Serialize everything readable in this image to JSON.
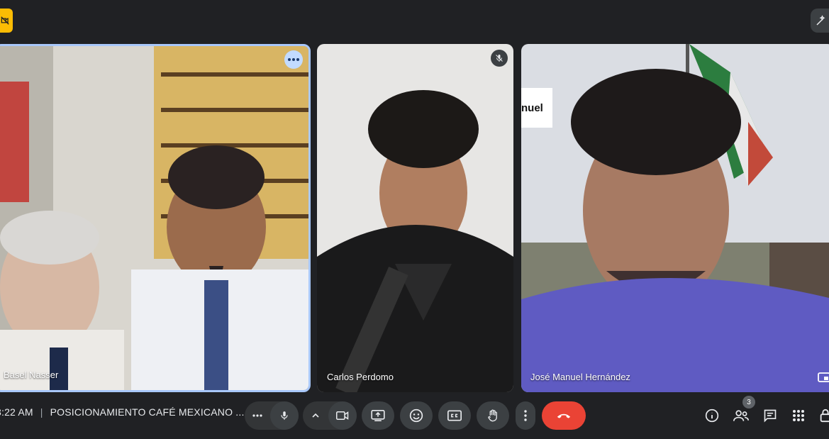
{
  "participants": [
    {
      "name": "Basel Nasser"
    },
    {
      "name": "Carlos Perdomo"
    },
    {
      "name": "José Manuel Hernández"
    }
  ],
  "overlay_text": "nuel",
  "meeting": {
    "time": "3:22 AM",
    "title": "POSICIONAMIENTO CAFÉ MEXICANO ..."
  },
  "people_count": "3",
  "icons": [
    "camera-off-icon",
    "sparkle-pen-icon",
    "more-horizontal-icon",
    "mic-off-icon",
    "mic-icon",
    "chevron-up-icon",
    "camera-icon",
    "present-icon",
    "emoji-icon",
    "captions-icon",
    "raise-hand-icon",
    "more-vertical-icon",
    "end-call-icon",
    "info-icon",
    "people-icon",
    "chat-icon",
    "activities-icon",
    "lock-icon",
    "pip-icon"
  ],
  "colors": {
    "background": "#202124",
    "accent": "#a8c7fa",
    "end_call": "#ea4335",
    "badge": "#fbbc04"
  }
}
